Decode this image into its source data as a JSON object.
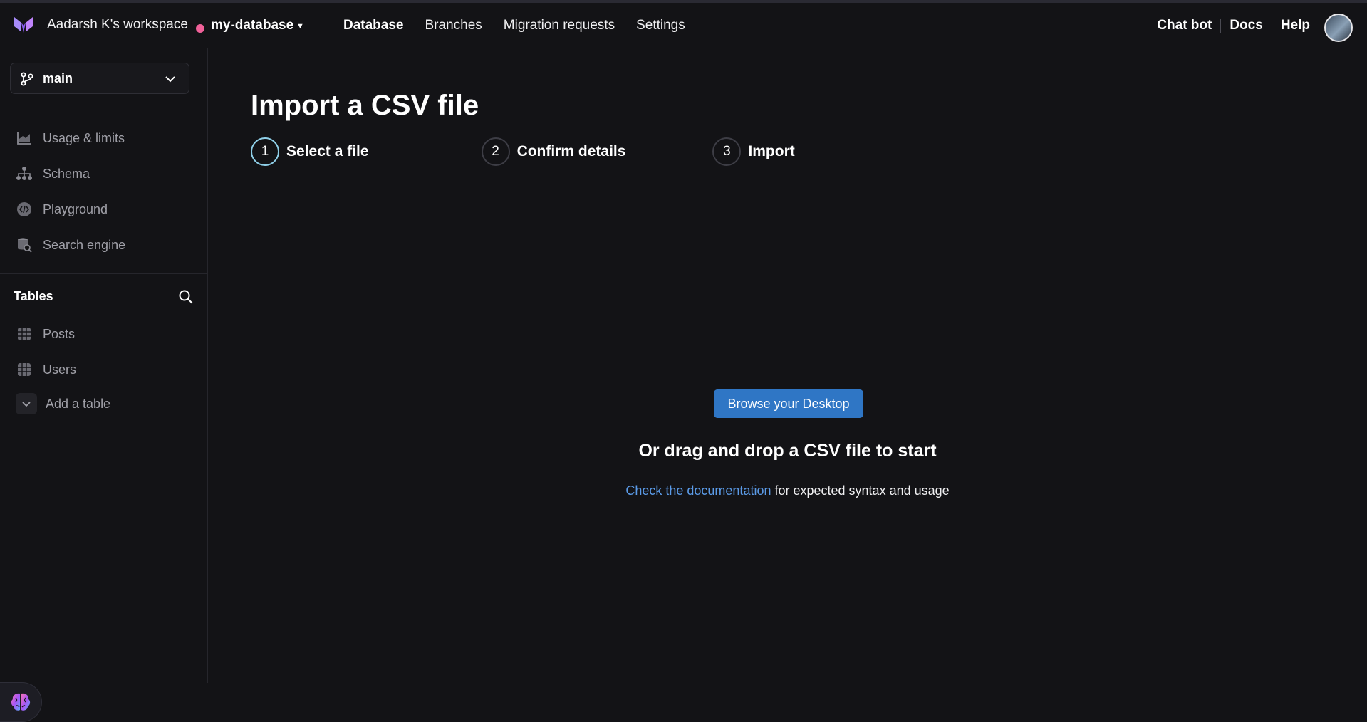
{
  "header": {
    "workspace": "Aadarsh K's workspace",
    "database": "my-database",
    "nav": [
      {
        "label": "Database",
        "active": true
      },
      {
        "label": "Branches",
        "active": false
      },
      {
        "label": "Migration requests",
        "active": false
      },
      {
        "label": "Settings",
        "active": false
      }
    ],
    "right_links": [
      "Chat bot",
      "Docs",
      "Help"
    ],
    "db_status_color": "#f06199"
  },
  "sidebar": {
    "branch": "main",
    "items": [
      {
        "label": "Usage & limits",
        "icon": "chart-area-icon"
      },
      {
        "label": "Schema",
        "icon": "hierarchy-icon"
      },
      {
        "label": "Playground",
        "icon": "code-icon"
      },
      {
        "label": "Search engine",
        "icon": "database-search-icon"
      }
    ],
    "tables_title": "Tables",
    "tables": [
      {
        "label": "Posts",
        "icon": "grid-icon"
      },
      {
        "label": "Users",
        "icon": "grid-icon"
      }
    ],
    "add_table": "Add a table"
  },
  "main": {
    "title": "Import a CSV file",
    "steps": [
      {
        "number": "1",
        "label": "Select a file",
        "current": true
      },
      {
        "number": "2",
        "label": "Confirm details",
        "current": false
      },
      {
        "number": "3",
        "label": "Import",
        "current": false
      }
    ],
    "browse_button": "Browse your Desktop",
    "drop_text": "Or drag and drop a CSV file to start",
    "doc_link": "Check the documentation",
    "doc_suffix": " for expected syntax and usage"
  },
  "colors": {
    "background": "#131316",
    "accent": "#2f76c5",
    "link": "#5b9be8",
    "step_active": "#8fcfe8"
  }
}
